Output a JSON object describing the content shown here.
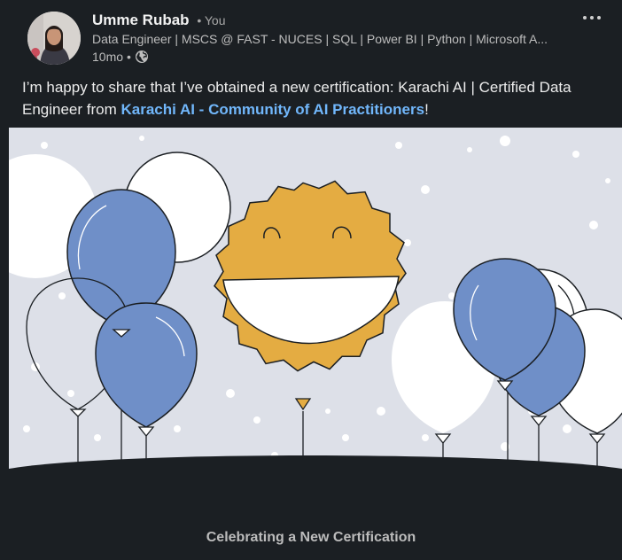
{
  "author": {
    "name": "Umme Rubab",
    "you_badge": "• You",
    "headline": "Data Engineer | MSCS @ FAST - NUCES | SQL | Power BI | Python | Microsoft A...",
    "time": "10mo",
    "separator": "•",
    "visibility_icon": "globe-icon"
  },
  "menu": {
    "icon": "more-dots-icon"
  },
  "post": {
    "text_before": "I’m happy to share that I’ve obtained a new certification: Karachi AI | Certified Data Engineer from ",
    "org_link": "Karachi AI - Community of AI Practitioners",
    "text_after": "!"
  },
  "image": {
    "caption": "Celebrating a New Certification",
    "colors": {
      "background": "#dde0e8",
      "blue_balloon": "#6f8fc8",
      "badge": "#e4ac42",
      "dark_band": "#1b1f23"
    }
  }
}
